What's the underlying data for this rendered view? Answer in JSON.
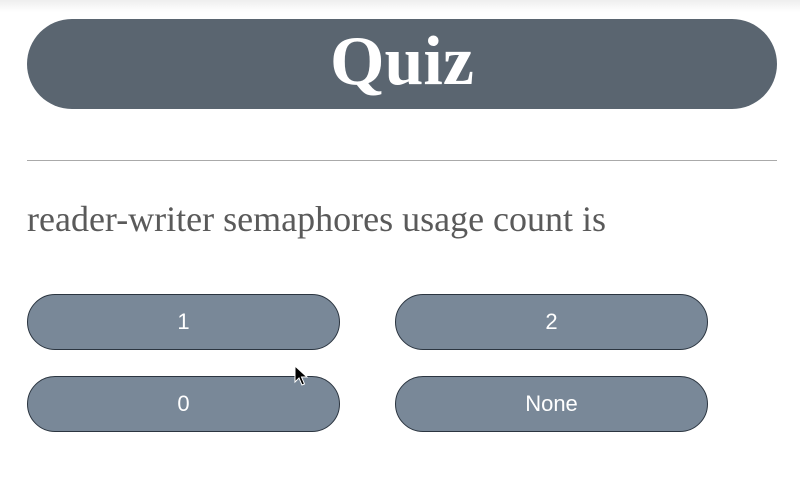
{
  "quiz": {
    "title": "Quiz",
    "question": "reader-writer semaphores usage count is",
    "answers": [
      {
        "label": "1"
      },
      {
        "label": "2"
      },
      {
        "label": "0"
      },
      {
        "label": "None"
      }
    ]
  },
  "colors": {
    "title_bar": "#5a6570",
    "answer_button": "#798898",
    "answer_border": "#2b3540",
    "question_text": "#5a5a5a"
  },
  "icons": {
    "cursor": "mouse-pointer-icon"
  }
}
